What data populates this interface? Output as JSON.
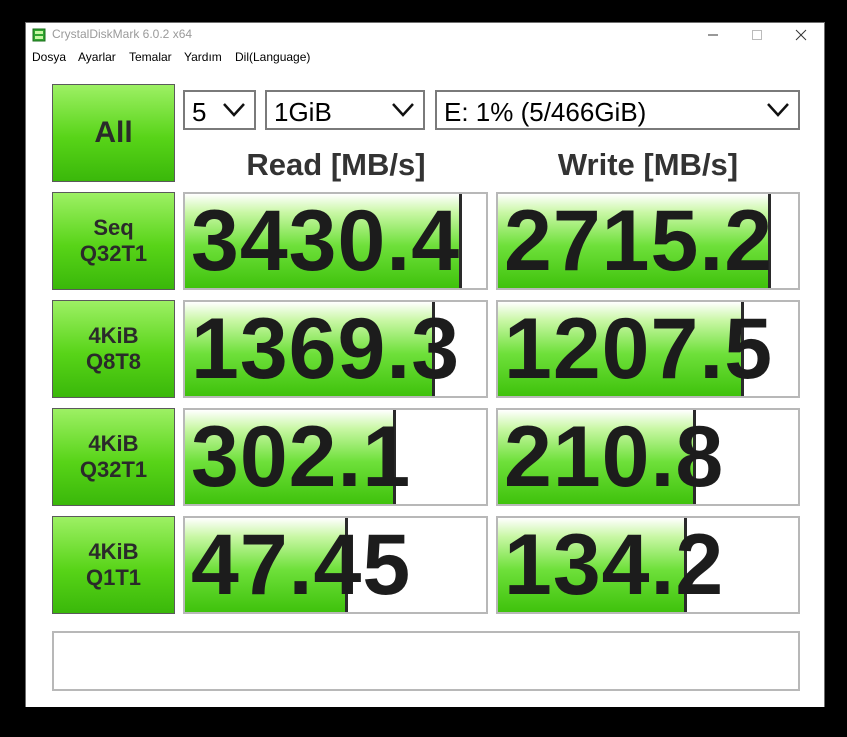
{
  "window": {
    "title": "CrystalDiskMark 6.0.2 x64"
  },
  "menu": [
    "Dosya",
    "Ayarlar",
    "Temalar",
    "Yardım",
    "Dil(Language)"
  ],
  "controls": {
    "count": "5",
    "size": "1GiB",
    "drive": "E: 1% (5/466GiB)"
  },
  "all_label": "All",
  "headers": {
    "read": "Read [MB/s]",
    "write": "Write [MB/s]"
  },
  "tests": [
    {
      "label": "Seq\nQ32T1",
      "read": "3430.4",
      "write": "2715.2",
      "read_fill": 0.91,
      "write_fill": 0.9
    },
    {
      "label": "4KiB\nQ8T8",
      "read": "1369.3",
      "write": "1207.5",
      "read_fill": 0.82,
      "write_fill": 0.81
    },
    {
      "label": "4KiB\nQ32T1",
      "read": "302.1",
      "write": "210.8",
      "read_fill": 0.69,
      "write_fill": 0.65
    },
    {
      "label": "4KiB\nQ1T1",
      "read": "47.45",
      "write": "134.2",
      "read_fill": 0.53,
      "write_fill": 0.62
    }
  ],
  "status_text": "",
  "colors": {
    "accent_green": "#58d418",
    "border_gray": "#b8b8b8",
    "text_dark": "#1c1c1c"
  }
}
